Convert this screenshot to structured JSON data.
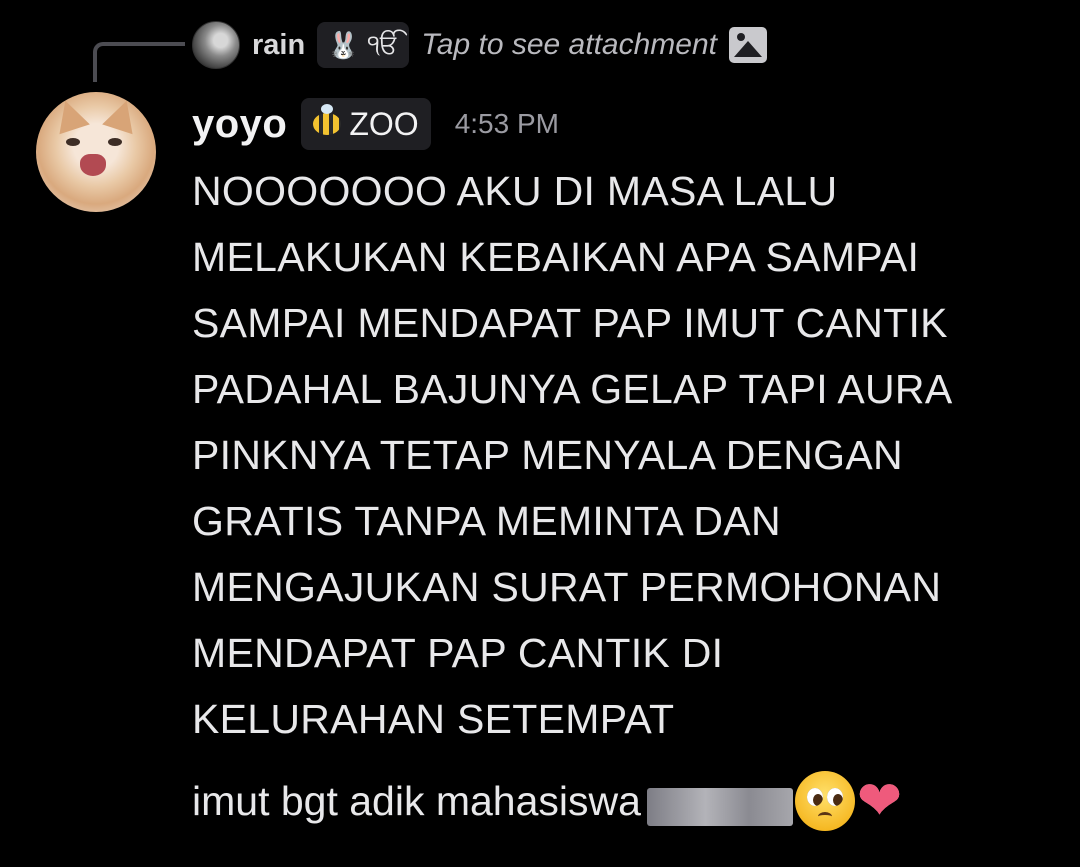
{
  "reply": {
    "username": "rain",
    "tag_icon": "bunny-icon",
    "tag_text": "ੴ",
    "snippet": "Tap to see attachment",
    "attachment_icon": "image-icon"
  },
  "author": {
    "username": "yoyo",
    "avatar": "kitten-avatar",
    "tag_icon": "bee-icon",
    "tag_text": "ZOO",
    "timestamp": "4:53 PM"
  },
  "message": {
    "lines": [
      "NOOOOOOO AKU DI MASA LALU",
      "MELAKUKAN KEBAIKAN APA SAMPAI",
      "SAMPAI MENDAPAT PAP IMUT CANTIK",
      "PADAHAL BAJUNYA GELAP TAPI AURA",
      "PINKNYA TETAP MENYALA DENGAN",
      "GRATIS TANPA MEMINTA DAN",
      "MENGAJUKAN SURAT PERMOHONAN",
      "MENDAPAT PAP CANTIK DI",
      "KELURAHAN SETEMPAT"
    ],
    "second_message": {
      "text": "imut bgt adik mahasiswa",
      "emojis": [
        "pleading-face",
        "pink-heart"
      ]
    }
  },
  "colors": {
    "background": "#000000",
    "text": "#e8e8ea",
    "muted": "#9b9ba2",
    "tag_bg": "#1f1f23"
  }
}
